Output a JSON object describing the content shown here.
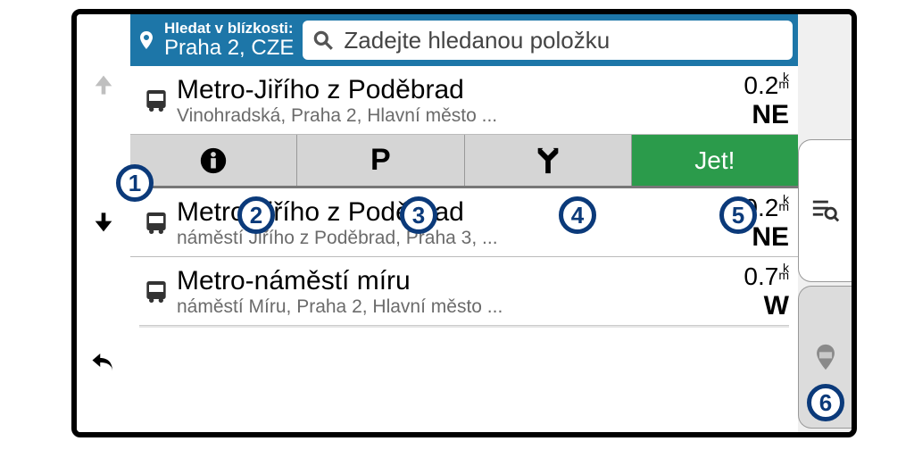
{
  "header": {
    "search_label": "Hledat v blízkosti:",
    "location": "Praha 2, CZE",
    "search_placeholder": "Zadejte hledanou položku"
  },
  "actions": {
    "go_label": "Jet!"
  },
  "results": [
    {
      "title": "Metro-Jiřího z Poděbrad",
      "subtitle": "Vinohradská, Praha 2, Hlavní město ...",
      "distance": "0.2",
      "unit": "km",
      "direction": "NE"
    },
    {
      "title": "Metro-Jiřího z Poděbrad",
      "subtitle": "náměstí Jiřího z Poděbrad, Praha 3, ...",
      "distance": "0.2",
      "unit": "km",
      "direction": "NE"
    },
    {
      "title": "Metro-náměstí míru",
      "subtitle": "náměstí Míru, Praha 2, Hlavní město ...",
      "distance": "0.7",
      "unit": "km",
      "direction": "W"
    }
  ],
  "callouts": [
    "1",
    "2",
    "3",
    "4",
    "5",
    "6"
  ]
}
